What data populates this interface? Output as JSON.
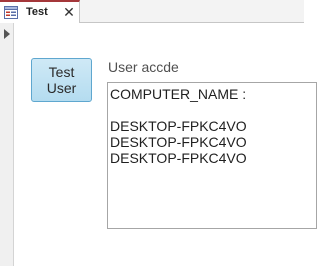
{
  "tab": {
    "title": "Test",
    "close_glyph": "✕",
    "icon": "form-icon",
    "accent_color": "#a4373a"
  },
  "form": {
    "button_label": "Test\nUser",
    "label": "User accde",
    "textbox_lines": [
      "COMPUTER_NAME :",
      "",
      "DESKTOP-FPKC4VO",
      "DESKTOP-FPKC4VO",
      "DESKTOP-FPKC4VO"
    ]
  }
}
